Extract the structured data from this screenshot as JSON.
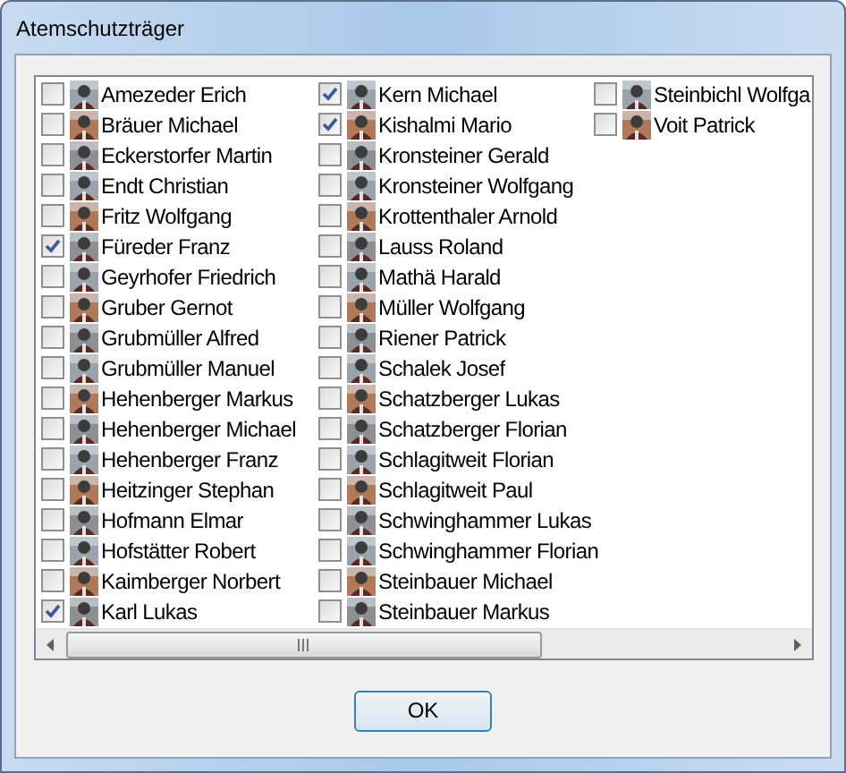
{
  "window": {
    "title": "Atemschutzträger"
  },
  "people": [
    {
      "name": "Amezeder Erich",
      "checked": false
    },
    {
      "name": "Bräuer Michael",
      "checked": false
    },
    {
      "name": "Eckerstorfer Martin",
      "checked": false
    },
    {
      "name": "Endt Christian",
      "checked": false
    },
    {
      "name": "Fritz Wolfgang",
      "checked": false
    },
    {
      "name": "Füreder Franz",
      "checked": true
    },
    {
      "name": "Geyrhofer Friedrich",
      "checked": false
    },
    {
      "name": "Gruber Gernot",
      "checked": false
    },
    {
      "name": "Grubmüller Alfred",
      "checked": false
    },
    {
      "name": "Grubmüller Manuel",
      "checked": false
    },
    {
      "name": "Hehenberger Markus",
      "checked": false
    },
    {
      "name": "Hehenberger Michael",
      "checked": false
    },
    {
      "name": "Hehenberger Franz",
      "checked": false
    },
    {
      "name": "Heitzinger Stephan",
      "checked": false
    },
    {
      "name": "Hofmann Elmar",
      "checked": false
    },
    {
      "name": "Hofstätter Robert",
      "checked": false
    },
    {
      "name": "Kaimberger Norbert",
      "checked": false
    },
    {
      "name": "Karl Lukas",
      "checked": true
    },
    {
      "name": "Kern Michael",
      "checked": true
    },
    {
      "name": "Kishalmi Mario",
      "checked": true
    },
    {
      "name": "Kronsteiner Gerald",
      "checked": false
    },
    {
      "name": "Kronsteiner Wolfgang",
      "checked": false
    },
    {
      "name": "Krottenthaler Arnold",
      "checked": false
    },
    {
      "name": "Lauss Roland",
      "checked": false
    },
    {
      "name": "Mathä Harald",
      "checked": false
    },
    {
      "name": "Müller Wolfgang",
      "checked": false
    },
    {
      "name": "Riener Patrick",
      "checked": false
    },
    {
      "name": "Schalek Josef",
      "checked": false
    },
    {
      "name": "Schatzberger Lukas",
      "checked": false
    },
    {
      "name": "Schatzberger Florian",
      "checked": false
    },
    {
      "name": "Schlagitweit Florian",
      "checked": false
    },
    {
      "name": "Schlagitweit Paul",
      "checked": false
    },
    {
      "name": "Schwinghammer Lukas",
      "checked": false
    },
    {
      "name": "Schwinghammer Florian",
      "checked": false
    },
    {
      "name": "Steinbauer Michael",
      "checked": false
    },
    {
      "name": "Steinbauer Markus",
      "checked": false
    },
    {
      "name": "Steinbichl Wolfga",
      "checked": false
    },
    {
      "name": "Voit Patrick",
      "checked": false
    }
  ],
  "buttons": [
    {
      "label": "OK"
    }
  ]
}
